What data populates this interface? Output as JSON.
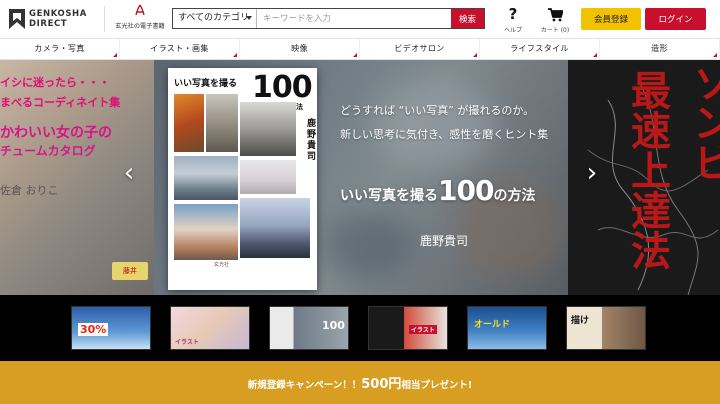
{
  "header": {
    "logo_line1": "GENKOSHA",
    "logo_line2": "DIRECT",
    "ebook_label": "玄光社の電子書籍",
    "search": {
      "category_selected": "すべてのカテゴリ",
      "placeholder": "キーワードを入力",
      "button_label": "検索"
    },
    "help_label": "ヘルプ",
    "cart_label": "カート (0)",
    "register_label": "会員登録",
    "login_label": "ログイン",
    "accent_color": "#c8102e",
    "register_color": "#f2c200"
  },
  "categories": [
    "カメラ・写真",
    "イラスト・画集",
    "映像",
    "ビデオサロン",
    "ライフスタイル",
    "造形"
  ],
  "hero": {
    "left_slide": {
      "line1": "イシに迷ったら・・・",
      "line2": "まべるコーディネイト集",
      "line3": "かわいい女の子の",
      "line4": "チュームカタログ",
      "line5": "佐倉 おりこ",
      "badge": "藤井"
    },
    "book": {
      "cover_title": "いい写真を撮る",
      "cover_number": "100",
      "cover_subtitle": "の方法",
      "cover_author": "鹿野貴司",
      "publisher_mark": "玄光社"
    },
    "tagline_1": "どうすれば “いい写真” が撮れるのか。",
    "tagline_2": "新しい思考に気付き、感性を磨くヒント集",
    "title_prefix": "いい写真を撮る",
    "title_number": "100",
    "title_suffix": "の方法",
    "author": "鹿野貴司",
    "right_slide_text_1": "ゾンビ",
    "right_slide_text_2": "最速上達法"
  },
  "thumbnails": [
    {
      "label": "30%"
    },
    {
      "label": "イラスト"
    },
    {
      "label": "100"
    },
    {
      "label": "イラスト"
    },
    {
      "label": "オールド"
    },
    {
      "label": "描け"
    }
  ],
  "campaign": {
    "prefix": "新規登録キャンペーン！！",
    "amount": "500円",
    "suffix": "相当プレゼント!"
  }
}
